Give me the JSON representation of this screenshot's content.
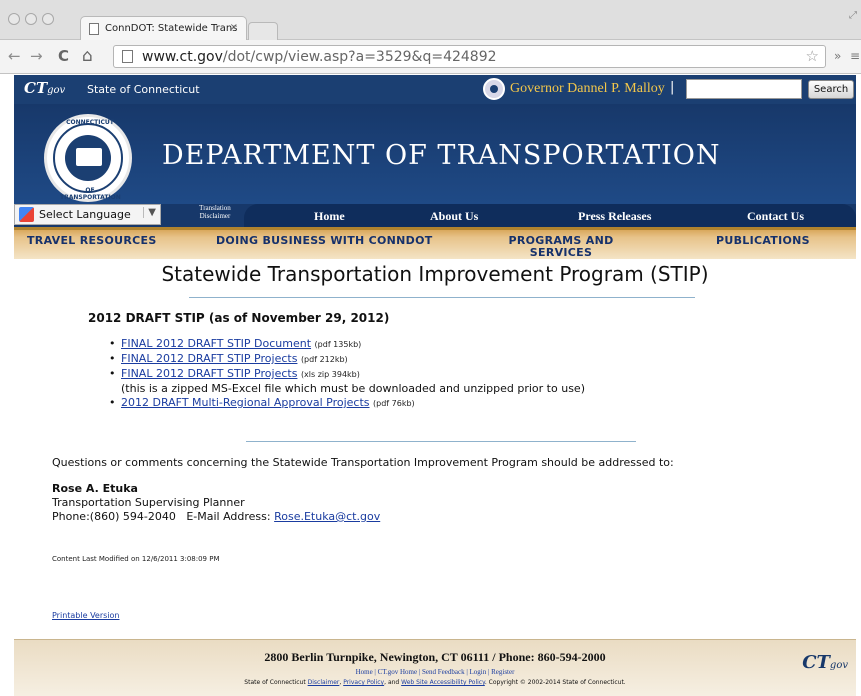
{
  "browser": {
    "tab_title": "ConnDOT: Statewide Trans",
    "tab_close": "×",
    "url_host": "www.ct.gov",
    "url_path": "/dot/cwp/view.asp?a=3529&q=424892",
    "star": "☆",
    "extension_glyph": "»",
    "menu_glyph": "≡",
    "back": "←",
    "forward": "→",
    "reload": "C",
    "home": "⌂"
  },
  "ctbar": {
    "logo_ct": "CT",
    "logo_gov": "gov",
    "state_label": "State of Connecticut",
    "governor": "Governor Dannel P. Malloy",
    "separator": "|",
    "search_placeholder": "",
    "search_button": "Search"
  },
  "banner": {
    "title": "DEPARTMENT OF TRANSPORTATION",
    "seal_top": "CONNECTICUT",
    "seal_bottom": "OF TRANSPORTATION"
  },
  "nav": {
    "select_language": "Select Language",
    "select_arrow": "▼",
    "translation": "Translation",
    "disclaimer": "Disclaimer",
    "items": [
      "Home",
      "About Us",
      "Press Releases",
      "Contact Us"
    ]
  },
  "goldnav": {
    "items": [
      "TRAVEL RESOURCES",
      "DOING BUSINESS WITH CONNDOT",
      "PROGRAMS AND SERVICES",
      "PUBLICATIONS"
    ]
  },
  "content": {
    "heading": "Statewide Transportation Improvement Program (STIP)",
    "subheading": "2012  DRAFT STIP (as of November 29, 2012)",
    "documents": [
      {
        "label": "FINAL 2012 DRAFT STIP Document",
        "meta": "(pdf 135kb)"
      },
      {
        "label": "FINAL 2012 DRAFT STIP Projects",
        "meta": "(pdf 212kb)"
      },
      {
        "label": "FINAL 2012 DRAFT STIP Projects",
        "meta": "(xls zip 394kb)"
      },
      {
        "label": "2012 DRAFT Multi-Regional Approval Projects",
        "meta": "(pdf 76kb)"
      }
    ],
    "zip_note": "(this is a zipped MS-Excel file which must be downloaded and unzipped prior to use)",
    "questions": "Questions or comments concerning the Statewide Transportation Improvement Program should be addressed to:",
    "contact_name": "Rose A. Etuka",
    "contact_title": "Transportation Supervising Planner",
    "phone_label": "Phone:(860) 594-2040",
    "email_label": "E-Mail Address:",
    "email": "Rose.Etuka@ct.gov",
    "modified": "Content Last Modified on 12/6/2011 3:08:09 PM",
    "printable": "Printable Version"
  },
  "footer": {
    "address": "2800 Berlin Turnpike, Newington, CT 06111 / Phone: 860-594-2000",
    "links": "Home | CT.gov Home | Send Feedback | Login | Register",
    "copy_prefix": "State of Connecticut",
    "disclaimer": "Disclaimer",
    "privacy": "Privacy Policy",
    "accessibility": "Web Site Accessibility Policy",
    "copy_suffix": "Copyright © 2002-2014 State of Connecticut.",
    "and": "and",
    "comma": ",",
    "dot": "."
  }
}
